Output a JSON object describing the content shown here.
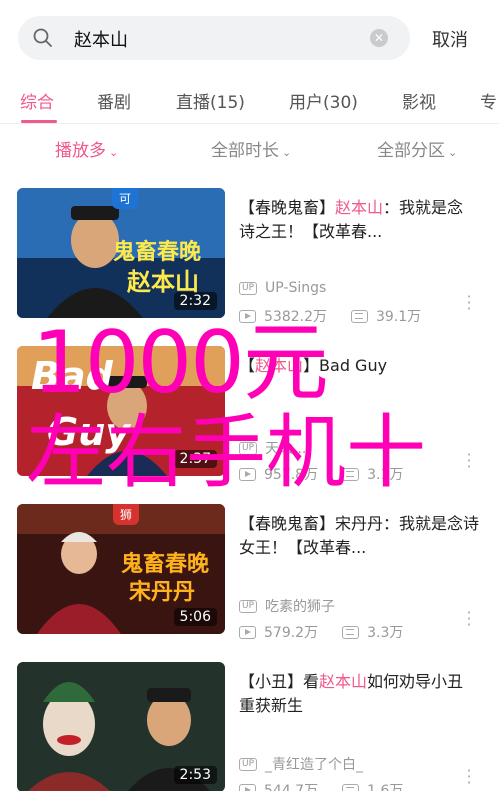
{
  "search": {
    "query": "赵本山",
    "cancel_label": "取消"
  },
  "tabs": [
    {
      "label": "综合",
      "active": true
    },
    {
      "label": "番剧",
      "active": false
    },
    {
      "label": "直播(15)",
      "active": false
    },
    {
      "label": "用户(30)",
      "active": false
    },
    {
      "label": "影视",
      "active": false
    },
    {
      "label": "专",
      "active": false
    }
  ],
  "filters": [
    {
      "label": "播放多",
      "active": true
    },
    {
      "label": "全部时长",
      "active": false
    },
    {
      "label": "全部分区",
      "active": false
    }
  ],
  "videos": [
    {
      "title_pre": "【春晚鬼畜】",
      "title_hl": "赵本山",
      "title_post": "：我就是念诗之王！【改革春...",
      "uploader": "UP-Sings",
      "views": "5382.2万",
      "danmaku": "39.1万",
      "duration": "2:32",
      "thumb_caption_1": "鬼畜春晚",
      "thumb_caption_2": "赵本山",
      "badge": "可"
    },
    {
      "title_pre": "【",
      "title_hl": "赵本山",
      "title_post": "】Bad Guy",
      "uploader": "天绘...",
      "views": "957.8万",
      "danmaku": "3.1万",
      "duration": "2:37",
      "thumb_caption_1": "Bad",
      "thumb_caption_2": "Guy",
      "badge": ""
    },
    {
      "title_pre": "【春晚鬼畜】宋丹丹：我就是念诗女王！【改革春...",
      "title_hl": "",
      "title_post": "",
      "uploader": "吃素的狮子",
      "views": "579.2万",
      "danmaku": "3.3万",
      "duration": "5:06",
      "thumb_caption_1": "鬼畜春晚",
      "thumb_caption_2": "宋丹丹",
      "badge": "狮"
    },
    {
      "title_pre": "【小丑】看",
      "title_hl": "赵本山",
      "title_post": "如何劝导小丑重获新生",
      "uploader": "_青红造了个白_",
      "views": "544.7万",
      "danmaku": "1.6万",
      "duration": "2:53",
      "thumb_caption_1": "",
      "thumb_caption_2": "",
      "badge": ""
    }
  ],
  "watermark": {
    "line1": "1000元",
    "line2": "左右手机十"
  },
  "colors": {
    "accent": "#f0598d",
    "watermark": "#ff00b7"
  }
}
